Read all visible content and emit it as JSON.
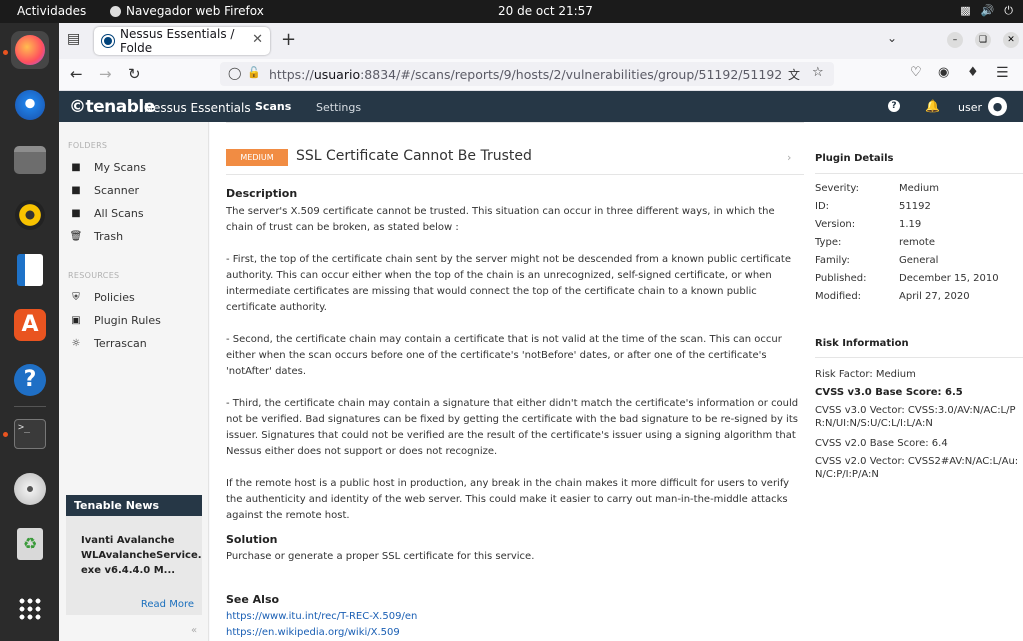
{
  "topbar": {
    "activities": "Actividades",
    "app_name": "Navegador web Firefox",
    "clock": "20 de oct  21:57"
  },
  "browser": {
    "tab_title": "Nessus Essentials / Folde",
    "url_prefix": "https://",
    "url_host": "usuario",
    "url_rest": ":8834/#/scans/reports/9/hosts/2/vulnerabilities/group/51192/51192"
  },
  "nessus": {
    "logo": "©tenable",
    "product": "Nessus Essentials",
    "nav_scans": "Scans",
    "nav_settings": "Settings",
    "user": "user"
  },
  "sidebar": {
    "folders_title": "FOLDERS",
    "folders": [
      {
        "label": "My Scans",
        "icon": "folder-icon"
      },
      {
        "label": "Scanner",
        "icon": "folder-icon"
      },
      {
        "label": "All Scans",
        "icon": "folder-icon"
      },
      {
        "label": "Trash",
        "icon": "trash-icon"
      }
    ],
    "resources_title": "RESOURCES",
    "resources": [
      {
        "label": "Policies",
        "icon": "shield-icon"
      },
      {
        "label": "Plugin Rules",
        "icon": "plugin-icon"
      },
      {
        "label": "Terrascan",
        "icon": "terrascan-icon"
      }
    ],
    "news_title": "Tenable News",
    "news_body": "Ivanti Avalanche WLAvalancheService. exe v6.4.4.0 M...",
    "news_more": "Read More"
  },
  "vulnerability": {
    "severity_badge": "MEDIUM",
    "title": "SSL Certificate Cannot Be Trusted",
    "description_heading": "Description",
    "description": [
      "The server's X.509 certificate cannot be trusted. This situation can occur in three different ways, in which the chain of trust can be broken, as stated below :",
      "- First, the top of the certificate chain sent by the server might not be descended from a known public certificate authority. This can occur either when the top of the chain is an unrecognized, self-signed certificate, or when intermediate certificates are missing that would connect the top of the certificate chain to a known public certificate authority.",
      "- Second, the certificate chain may contain a certificate that is not valid at the time of the scan. This can occur either when the scan occurs before one of the certificate's 'notBefore' dates, or after one of the certificate's 'notAfter' dates.",
      "- Third, the certificate chain may contain a signature that either didn't match the certificate's information or could not be verified. Bad signatures can be fixed by getting the certificate with the bad signature to be re-signed by its issuer. Signatures that could not be verified are the result of the certificate's issuer using a signing algorithm that Nessus either does not support or does not recognize.",
      "If the remote host is a public host in production, any break in the chain makes it more difficult for users to verify the authenticity and identity of the web server. This could make it easier to carry out man-in-the-middle attacks against the remote host."
    ],
    "solution_heading": "Solution",
    "solution": "Purchase or generate a proper SSL certificate for this service.",
    "see_also_heading": "See Also",
    "see_also": [
      "https://www.itu.int/rec/T-REC-X.509/en",
      "https://en.wikipedia.org/wiki/X.509"
    ]
  },
  "plugin_details": {
    "heading": "Plugin Details",
    "rows": [
      {
        "key": "Severity:",
        "value": "Medium"
      },
      {
        "key": "ID:",
        "value": "51192"
      },
      {
        "key": "Version:",
        "value": "1.19"
      },
      {
        "key": "Type:",
        "value": "remote"
      },
      {
        "key": "Family:",
        "value": "General"
      },
      {
        "key": "Published:",
        "value": "December 15, 2010"
      },
      {
        "key": "Modified:",
        "value": "April 27, 2020"
      }
    ]
  },
  "risk_info": {
    "heading": "Risk Information",
    "risk_factor": "Risk Factor: Medium",
    "cvss3_base": "CVSS v3.0 Base Score: 6.5",
    "cvss3_vector": "CVSS v3.0 Vector: CVSS:3.0/AV:N/AC:L/PR:N/UI:N/S:U/C:L/I:L/A:N",
    "cvss2_base": "CVSS v2.0 Base Score: 6.4",
    "cvss2_vector": "CVSS v2.0 Vector: CVSS2#AV:N/AC:L/Au:N/C:P/I:P/A:N"
  },
  "colors": {
    "nessus_header": "#263746",
    "severity_medium": "#f18c43",
    "link": "#1a5fb4"
  }
}
